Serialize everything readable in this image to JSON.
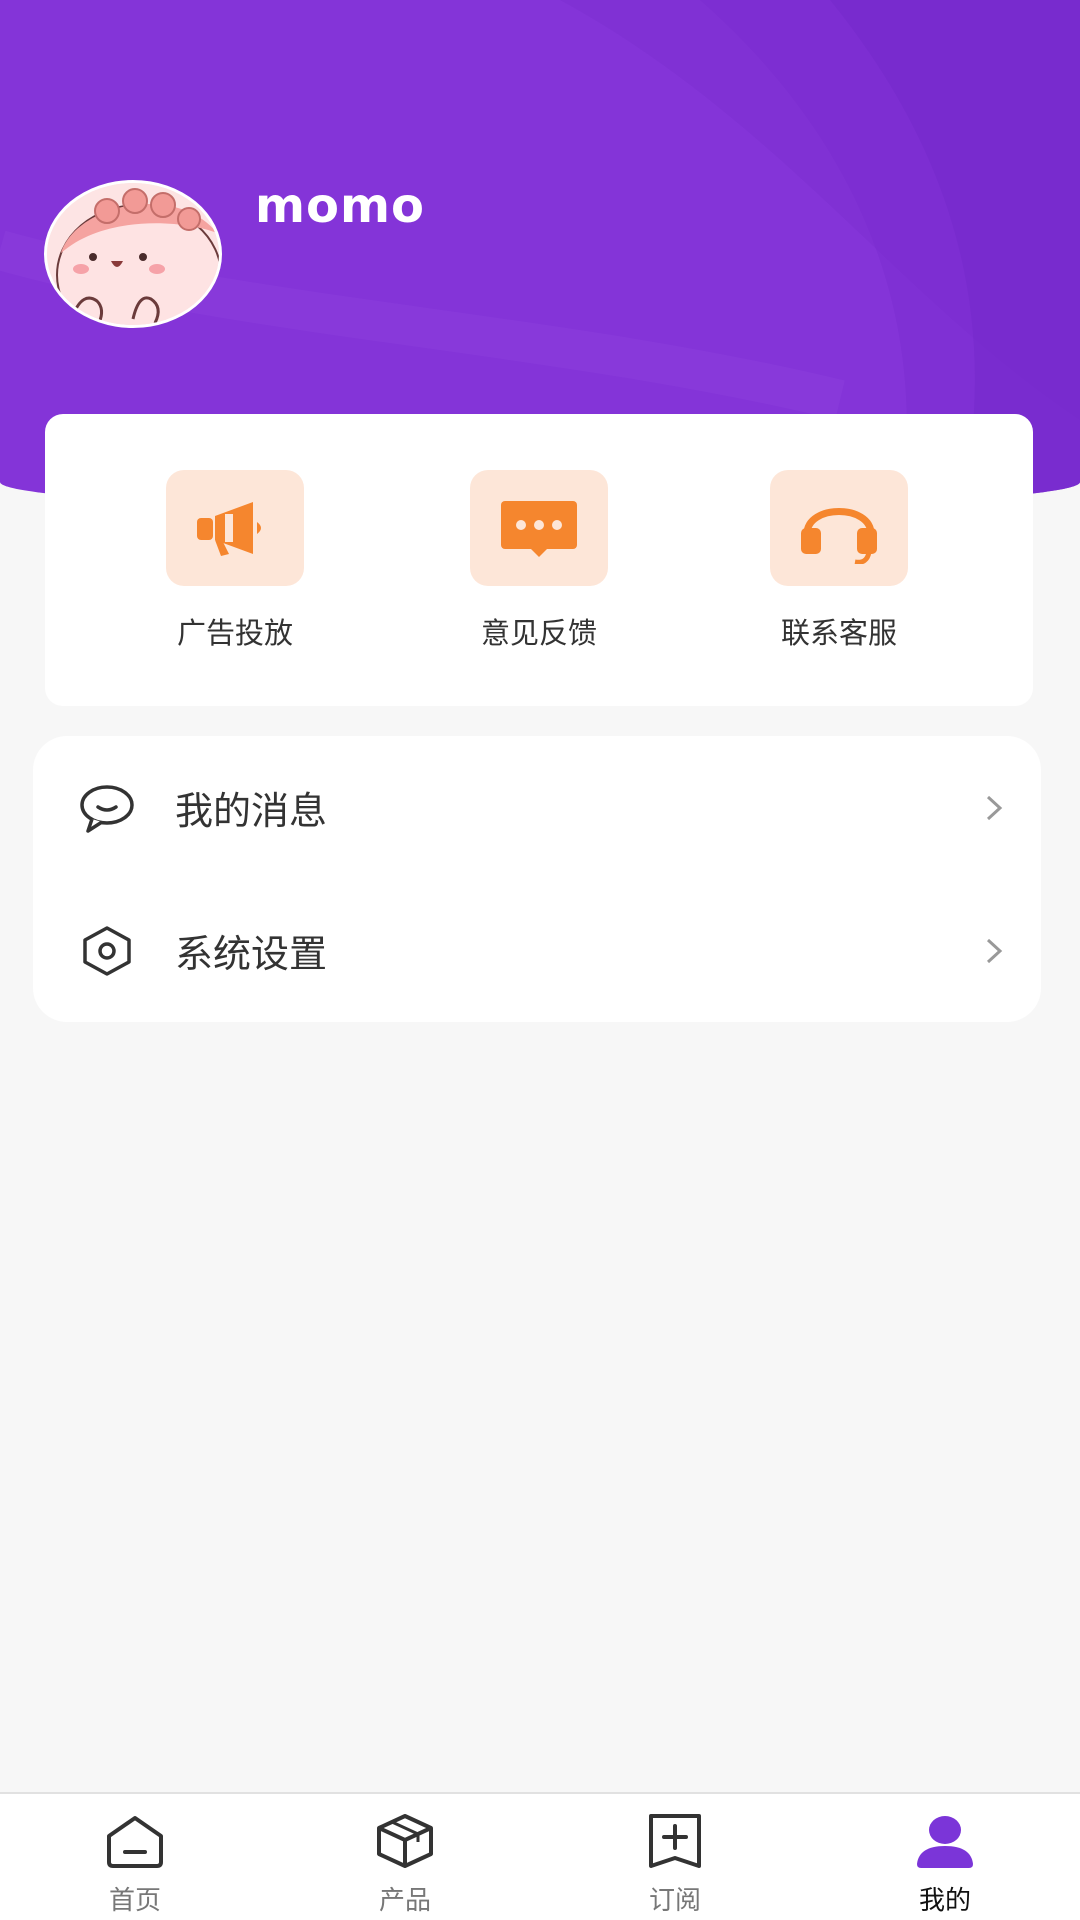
{
  "profile": {
    "username": "momo"
  },
  "quick_actions": [
    {
      "label": "广告投放",
      "icon": "megaphone-icon"
    },
    {
      "label": "意见反馈",
      "icon": "message-dots-icon"
    },
    {
      "label": "联系客服",
      "icon": "headset-icon"
    }
  ],
  "menu": [
    {
      "label": "我的消息",
      "icon": "speech-bubble-icon"
    },
    {
      "label": "系统设置",
      "icon": "hexagon-settings-icon"
    }
  ],
  "tabbar": {
    "items": [
      {
        "label": "首页",
        "icon": "home-icon"
      },
      {
        "label": "产品",
        "icon": "box-icon"
      },
      {
        "label": "订阅",
        "icon": "add-bookmark-icon"
      },
      {
        "label": "我的",
        "icon": "user-icon",
        "active": true
      }
    ]
  },
  "colors": {
    "header": "#8434d8",
    "accent_orange": "#f5862e",
    "icon_box_bg": "#fde6d8",
    "active_tab_icon": "#7b35d8"
  }
}
